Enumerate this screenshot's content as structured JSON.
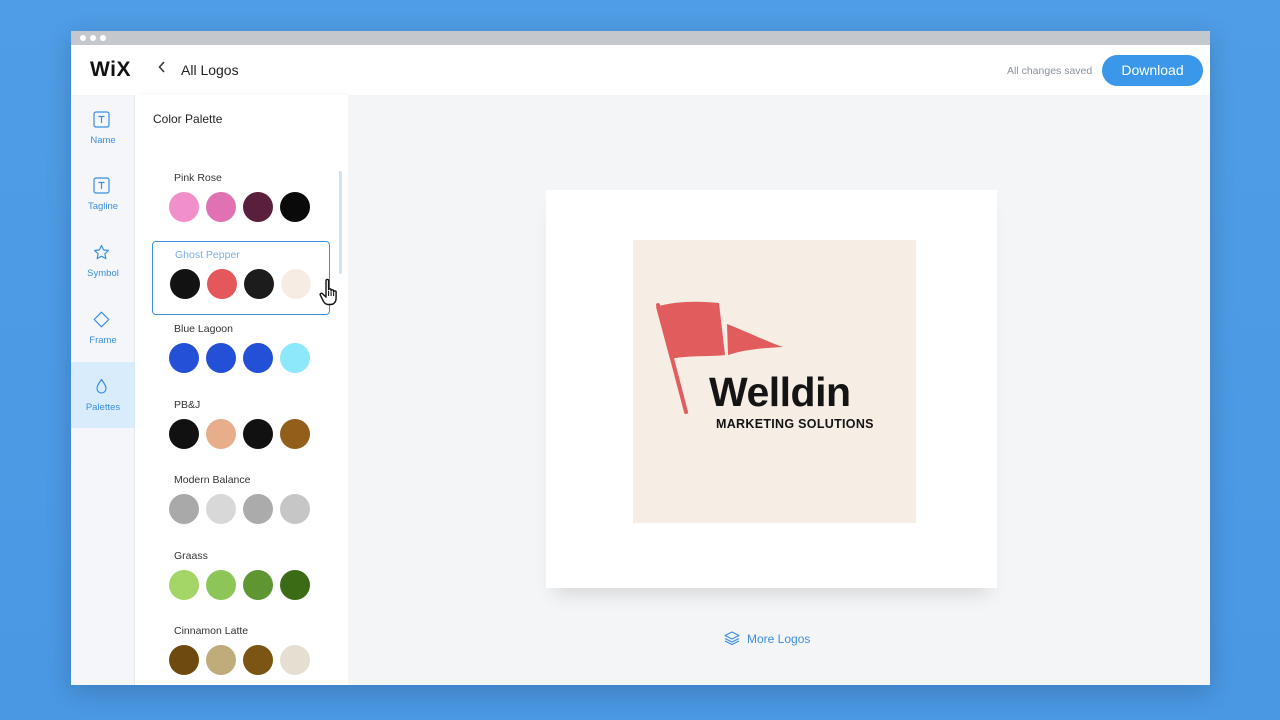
{
  "app": {
    "logo": "WiX"
  },
  "topbar": {
    "breadcrumb": "All Logos",
    "status": "All changes saved",
    "download_label": "Download"
  },
  "rail": {
    "items": [
      {
        "label": "Name",
        "icon": "text-box-icon"
      },
      {
        "label": "Tagline",
        "icon": "text-box-icon"
      },
      {
        "label": "Symbol",
        "icon": "star-icon"
      },
      {
        "label": "Frame",
        "icon": "diamond-icon"
      },
      {
        "label": "Palettes",
        "icon": "drop-icon",
        "active": true
      }
    ]
  },
  "panel": {
    "title": "Color Palette",
    "palettes": [
      {
        "name": "Pink Rose",
        "colors": [
          "#f08fc9",
          "#e071b2",
          "#5a1f3c",
          "#0a0a0a"
        ]
      },
      {
        "name": "Ghost Pepper",
        "colors": [
          "#121212",
          "#e4575a",
          "#1c1c1c",
          "#f7ece3"
        ],
        "selected": true
      },
      {
        "name": "Blue Lagoon",
        "colors": [
          "#2350d6",
          "#2350d6",
          "#2350d6",
          "#8de8fb"
        ]
      },
      {
        "name": "PB&J",
        "colors": [
          "#111111",
          "#e8ad8b",
          "#111111",
          "#925f1a"
        ]
      },
      {
        "name": "Modern Balance",
        "colors": [
          "#a9a9a9",
          "#d8d8d8",
          "#ababab",
          "#c6c6c6"
        ]
      },
      {
        "name": "Graass",
        "colors": [
          "#a4d567",
          "#8ec558",
          "#5f9632",
          "#3b6b14"
        ]
      },
      {
        "name": "Cinnamon Latte",
        "colors": [
          "#6e4a10",
          "#c0ab7b",
          "#7c5514",
          "#e5dfd2"
        ]
      }
    ]
  },
  "preview": {
    "brand_name": "Welldin",
    "tagline": "MARKETING SOLUTIONS",
    "more_logos": "More Logos"
  },
  "colors": {
    "accent": "#3b8fe0",
    "flag": "#e15c5c",
    "art_bg": "#f6ede4"
  }
}
